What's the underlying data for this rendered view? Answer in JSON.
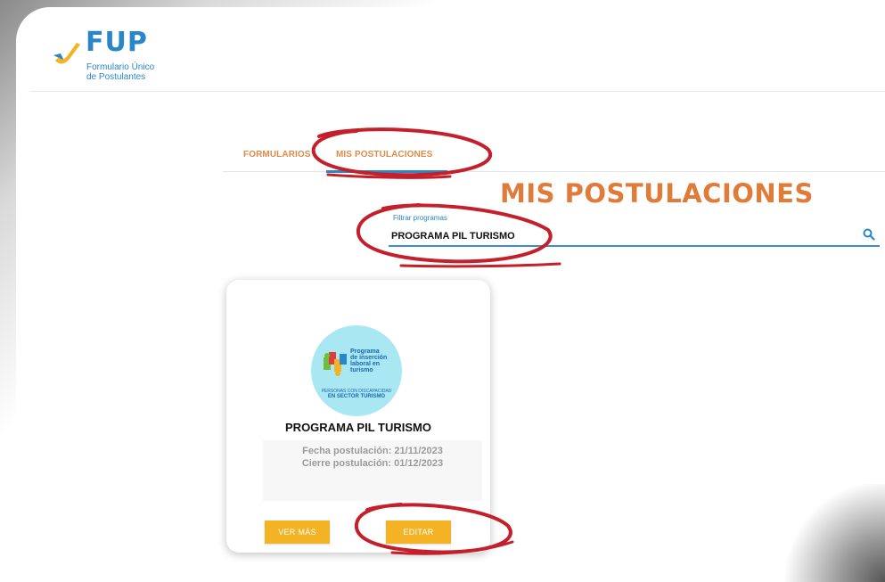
{
  "logo": {
    "title": "FUP",
    "subtitle_line1": "Formulario Único",
    "subtitle_line2": "de Postulantes"
  },
  "tabs": [
    {
      "label": "FORMULARIOS",
      "active": false
    },
    {
      "label": "MIS POSTULACIONES",
      "active": true
    }
  ],
  "page_title": "MIS POSTULACIONES",
  "search": {
    "label": "Filtrar programas",
    "value": "PROGRAMA PIL TURISMO"
  },
  "card": {
    "logo": {
      "line1": "Programa",
      "line2": "de inserción",
      "line3": "laboral en",
      "line4": "turismo",
      "tagline": "PERSONAS CON DISCAPACIDAD",
      "tagline2": "EN SECTOR TURISMO"
    },
    "title": "PROGRAMA PIL TURISMO",
    "fecha": "Fecha postulación: 21/11/2023",
    "cierre": "Cierre postulación: 01/12/2023",
    "ver_mas": "VER MÁS",
    "editar": "EDITAR"
  },
  "colors": {
    "brand_blue": "#2a86c8",
    "brand_orange": "#e07b3a",
    "button_yellow": "#f4b324",
    "annotation_red": "#c4202b"
  }
}
